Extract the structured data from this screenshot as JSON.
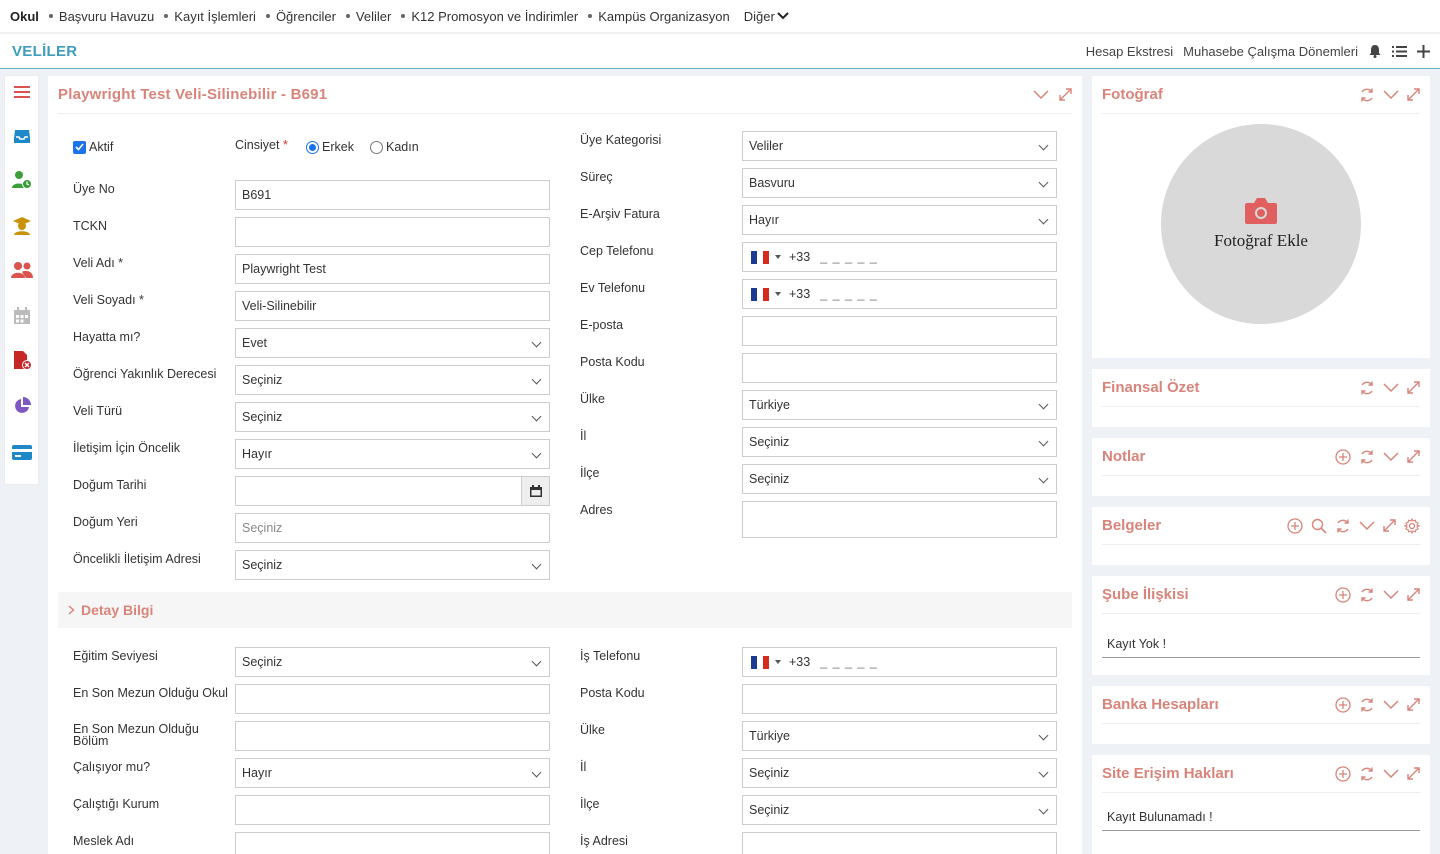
{
  "topnav": {
    "brand": "Okul",
    "items": [
      "Başvuru Havuzu",
      "Kayıt İşlemleri",
      "Öğrenciler",
      "Veliler",
      "K12 Promosyon ve İndirimler",
      "Kampüs Organizasyon"
    ],
    "more": "Diğer"
  },
  "subheader": {
    "title": "VELİLER",
    "links": [
      "Hesap Ekstresi",
      "Muhasebe Çalışma Dönemleri"
    ],
    "icons": [
      "bell-icon",
      "list-icon",
      "plus-icon"
    ]
  },
  "rail": {
    "icons": [
      "menu-icon",
      "inbox-icon",
      "user-clock-icon",
      "graduate-icon",
      "users-icon",
      "calendar-icon",
      "file-delete-icon",
      "pie-chart-icon",
      "card-icon"
    ],
    "colors": {
      "main": "#d9534f",
      "blue": "#1e88c8",
      "green": "#3a9e3a",
      "gold": "#c8930a",
      "gray": "#bbbbbb"
    }
  },
  "main": {
    "title": "Playwright Test Veli-Silinebilir - B691",
    "active": {
      "label": "Aktif",
      "checked": true
    },
    "gender": {
      "label": "Cinsiyet",
      "required": "*",
      "options": [
        "Erkek",
        "Kadın"
      ],
      "selected": "Erkek"
    },
    "left_fields": [
      {
        "label": "Üye No",
        "value": "B691"
      },
      {
        "label": "TCKN",
        "value": ""
      },
      {
        "label": "Veli Adı *",
        "value": "Playwright Test"
      },
      {
        "label": "Veli Soyadı *",
        "value": "Veli-Silinebilir"
      },
      {
        "label": "Hayatta mı?",
        "value": "Evet"
      },
      {
        "label": "Öğrenci Yakınlık Derecesi",
        "value": "Seçiniz"
      },
      {
        "label": "Veli Türü",
        "value": "Seçiniz"
      },
      {
        "label": "İletişim İçin Öncelik",
        "value": "Hayır"
      },
      {
        "label": "Doğum Tarihi",
        "value": ""
      },
      {
        "label": "Doğum Yeri",
        "placeholder": "Seçiniz"
      },
      {
        "label": "Öncelikli İletişim Adresi",
        "value": "Seçiniz"
      }
    ],
    "right_fields": [
      {
        "label": "Üye Kategorisi",
        "value": "Veliler"
      },
      {
        "label": "Süreç",
        "value": "Basvuru"
      },
      {
        "label": "E-Arşiv Fatura",
        "value": "Hayır"
      },
      {
        "label": "Cep Telefonu",
        "code": "+33",
        "mask": "_ _ _ _ _"
      },
      {
        "label": "Ev Telefonu",
        "code": "+33",
        "mask": "_ _ _ _ _"
      },
      {
        "label": "E-posta",
        "value": ""
      },
      {
        "label": "Posta Kodu",
        "value": ""
      },
      {
        "label": "Ülke",
        "value": "Türkiye"
      },
      {
        "label": "İl",
        "value": "Seçiniz"
      },
      {
        "label": "İlçe",
        "value": "Seçiniz"
      },
      {
        "label": "Adres",
        "value": ""
      }
    ],
    "detail": {
      "title": "Detay Bilgi",
      "left_fields": [
        {
          "label": "Eğitim Seviyesi",
          "value": "Seçiniz"
        },
        {
          "label": "En Son Mezun Olduğu Okul",
          "value": ""
        },
        {
          "label": "En Son Mezun Olduğu Bölüm",
          "value": ""
        },
        {
          "label": "Çalışıyor mu?",
          "value": "Hayır"
        },
        {
          "label": "Çalıştığı Kurum",
          "value": ""
        },
        {
          "label": "Meslek Adı",
          "value": ""
        }
      ],
      "right_fields": [
        {
          "label": "İş Telefonu",
          "code": "+33",
          "mask": "_ _ _ _ _"
        },
        {
          "label": "Posta Kodu",
          "value": ""
        },
        {
          "label": "Ülke",
          "value": "Türkiye"
        },
        {
          "label": "İl",
          "value": "Seçiniz"
        },
        {
          "label": "İlçe",
          "value": "Seçiniz"
        },
        {
          "label": "İş Adresi",
          "value": ""
        }
      ]
    }
  },
  "side": {
    "photo": {
      "title": "Fotoğraf",
      "add_label": "Fotoğraf Ekle"
    },
    "finance": {
      "title": "Finansal Özet"
    },
    "notes": {
      "title": "Notlar"
    },
    "docs": {
      "title": "Belgeler"
    },
    "branch": {
      "title": "Şube İlişkisi",
      "empty": "Kayıt Yok !"
    },
    "bank": {
      "title": "Banka Hesapları"
    },
    "access": {
      "title": "Site Erişim Hakları",
      "empty": "Kayıt Bulunamadı !"
    }
  },
  "colors": {
    "accent": "#d9847a",
    "page_title": "#3c9dbd",
    "check": "#1a73e8"
  }
}
